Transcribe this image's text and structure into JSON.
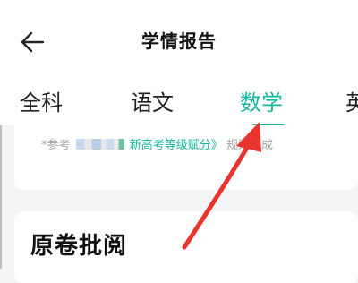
{
  "header": {
    "title": "学情报告",
    "back_icon": "back-arrow-icon"
  },
  "tabs": [
    {
      "label": "全科",
      "active": false
    },
    {
      "label": "语文",
      "active": false
    },
    {
      "label": "数学",
      "active": true
    },
    {
      "label": "英",
      "active": false
    }
  ],
  "note": {
    "prefix": "*参考",
    "link": "新高考等级赋分》",
    "suffix": "规则中成"
  },
  "section": {
    "title": "原卷批阅"
  },
  "colors": {
    "accent": "#18b7a0",
    "annotation_arrow": "#e8342f"
  }
}
